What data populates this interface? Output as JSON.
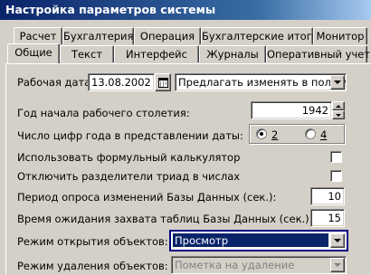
{
  "window": {
    "title": "Настройка параметров системы"
  },
  "tabs_back": [
    "Расчет",
    "Бухгалтерия",
    "Операция",
    "Бухгалтерские итоги",
    "Монитор"
  ],
  "tabs_front": [
    "Общие",
    "Текст",
    "Интерфейс",
    "Журналы",
    "Оперативный учет"
  ],
  "active_tab": "Общие",
  "form": {
    "work_date_label": "Рабочая дата:",
    "work_date_value": "13.08.2002",
    "work_date_mode": "Предлагать изменять в полночь",
    "century_label": "Год начала рабочего столетия:",
    "century_value": "1942",
    "year_digits_label": "Число цифр года в представлении даты:",
    "year_digits_options": [
      "2",
      "4"
    ],
    "year_digits_selected": "2",
    "formula_calc_label": "Использовать формульный калькулятор",
    "formula_calc_checked": false,
    "disable_triads_label": "Отключить разделители триад в числах",
    "disable_triads_checked": false,
    "poll_period_label": "Период опроса изменений Базы Данных (сек.):",
    "poll_period_value": "10",
    "lock_wait_label": "Время ожидания захвата таблиц Базы Данных (сек.):",
    "lock_wait_value": "15",
    "open_mode_label": "Режим открытия объектов:",
    "open_mode_value": "Просмотр",
    "delete_mode_label": "Режим удаления объектов:",
    "delete_mode_value": "Пометка на удаление"
  },
  "colors": {
    "title_bar": "#0a246a",
    "window_bg": "#d4d0c8",
    "selection": "#0a246a",
    "focus_border": "#000080"
  }
}
